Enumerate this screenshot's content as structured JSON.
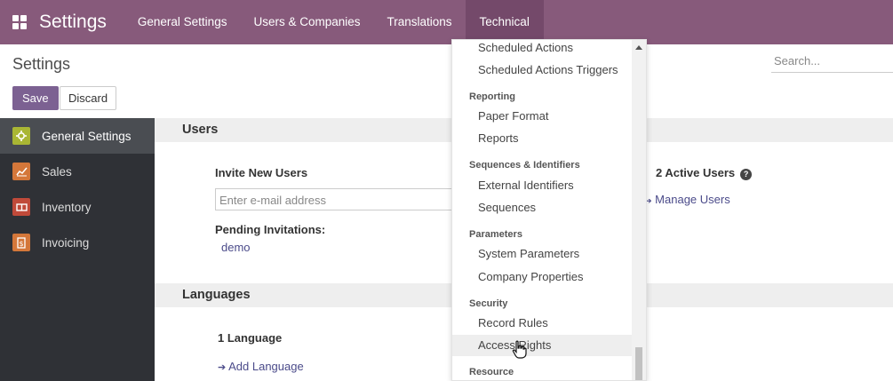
{
  "app": {
    "title": "Settings"
  },
  "topmenu": [
    "General Settings",
    "Users & Companies",
    "Translations",
    "Technical"
  ],
  "control": {
    "breadcrumb": "Settings",
    "save_label": "Save",
    "discard_label": "Discard",
    "search_placeholder": "Search..."
  },
  "sidebar": {
    "items": [
      "General Settings",
      "Sales",
      "Inventory",
      "Invoicing"
    ]
  },
  "users_section": {
    "title": "Users",
    "invite_label": "Invite New Users",
    "email_placeholder": "Enter e-mail address",
    "pending_label": "Pending Invitations:",
    "pending_user": "demo",
    "active_users": "2 Active Users",
    "help_glyph": "?",
    "manage_users": "Manage Users",
    "manage_arrow": "➔"
  },
  "languages_section": {
    "title": "Languages",
    "count_label": "1 Language",
    "add_language": "Add Language",
    "add_arrow": "➔"
  },
  "dropdown": {
    "groups": [
      {
        "header": "",
        "items": [
          "Scheduled Actions",
          "Scheduled Actions Triggers"
        ]
      },
      {
        "header": "Reporting",
        "items": [
          "Paper Format",
          "Reports"
        ]
      },
      {
        "header": "Sequences & Identifiers",
        "items": [
          "External Identifiers",
          "Sequences"
        ]
      },
      {
        "header": "Parameters",
        "items": [
          "System Parameters",
          "Company Properties"
        ]
      },
      {
        "header": "Security",
        "items": [
          "Record Rules",
          "Access Rights"
        ]
      },
      {
        "header": "Resource",
        "items": []
      }
    ]
  },
  "colors": {
    "topbar": "#875a7b",
    "save_button": "#7c6192",
    "sidebar": "#2f3136",
    "link": "#4b4b8a"
  }
}
